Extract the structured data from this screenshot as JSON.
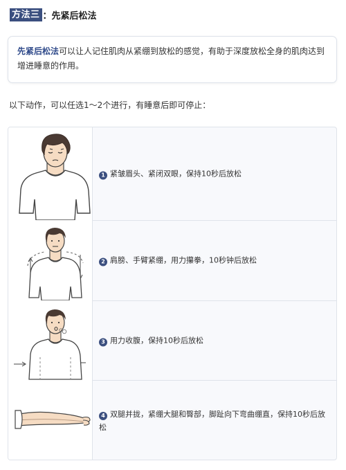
{
  "heading": {
    "badge": "方法三",
    "rest": "：先紧后松法"
  },
  "callout": {
    "keyword": "先紧后松法",
    "text": "可以让人记住肌肉从紧绷到放松的感觉，有助于深度放松全身的肌肉达到增进睡意的作用。"
  },
  "intro": "以下动作，可以任选1～2个进行，有睡意后即可停止：",
  "steps": [
    {
      "num": "1",
      "text": "紧皱眉头、紧闭双眼，保持10秒后放松"
    },
    {
      "num": "2",
      "text": "肩膀、手臂紧绷，用力攥拳，10秒钟后放松"
    },
    {
      "num": "3",
      "text": "用力收腹，保持10秒后放松"
    },
    {
      "num": "4",
      "text": "双腿并拢，紧绷大腿和臀部，脚趾向下弯曲绷直，保持10秒后放松"
    }
  ],
  "colors": {
    "accent": "#3b4f7f",
    "keyword": "#2f4a8a",
    "panel": "#f8f9fc",
    "border": "#dfe3ea"
  }
}
